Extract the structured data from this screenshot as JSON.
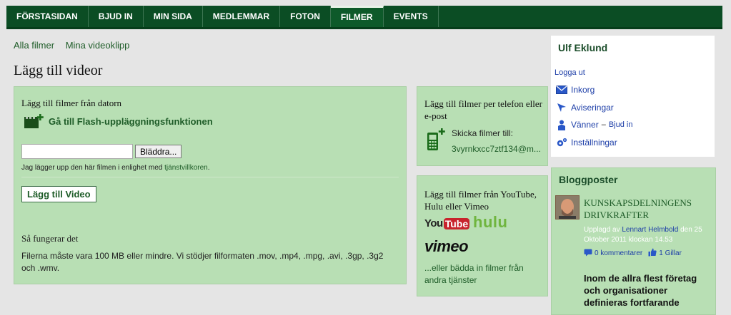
{
  "nav": {
    "items": [
      "FÖRSTASIDAN",
      "BJUD IN",
      "MIN SIDA",
      "MEDLEMMAR",
      "FOTON",
      "FILMER",
      "EVENTS"
    ],
    "active_index": 5
  },
  "subnav": {
    "all_films": "Alla filmer",
    "my_clips": "Mina videoklipp"
  },
  "page_title": "Lägg till videor",
  "upload": {
    "heading": "Lägg till filmer från datorn",
    "flash_link": "Gå till Flash-uppläggningsfunktionen",
    "file_value": "",
    "browse_label": "Bläddra...",
    "terms_text": "Jag lägger upp den här filmen i enlighet med ",
    "terms_link": "tjänstvillkoren",
    "terms_end": ".",
    "add_button": "Lägg till Video",
    "how_title": "Så fungerar det",
    "how_text": "Filerna måste vara 100 MB eller mindre. Vi stödjer filformaten .mov, .mp4, .mpg, .avi, .3gp, .3g2 och .wmv."
  },
  "phone": {
    "heading": "Lägg till filmer per telefon eller e-post",
    "send_label": "Skicka filmer till:",
    "email": "3vyrnkxcc7ztf134@m..."
  },
  "embed": {
    "heading": "Lägg till filmer från YouTube, Hulu eller Vimeo",
    "youtube_you": "You",
    "youtube_tube": "Tube",
    "hulu": "hulu",
    "vimeo": "vimeo",
    "other_link": "...eller bädda in filmer från andra tjänster"
  },
  "sidebar": {
    "user_name": "Ulf Eklund",
    "logout": "Logga ut",
    "inbox": "Inkorg",
    "notifications": "Aviseringar",
    "friends": "Vänner",
    "friends_dash": "–",
    "invite": "Bjud in",
    "settings": "Inställningar"
  },
  "blog": {
    "title": "Bloggposter",
    "post_title": "KUNSKAPSDELNINGENS DRIVKRAFTER",
    "posted_by": "Upplagd av ",
    "author": "Lennart Helmbold",
    "date": " den 25 Oktober 2011 klockan 14.53",
    "comments": "0 kommentarer",
    "likes": "1 Gillar",
    "body": "Inom de allra flest företag och organisationer definieras fortfarande"
  },
  "colors": {
    "nav_bg": "#0b4d24",
    "box_bg": "#b8dfb4",
    "link_green": "#1e5c28",
    "link_blue": "#1e3fa8"
  }
}
